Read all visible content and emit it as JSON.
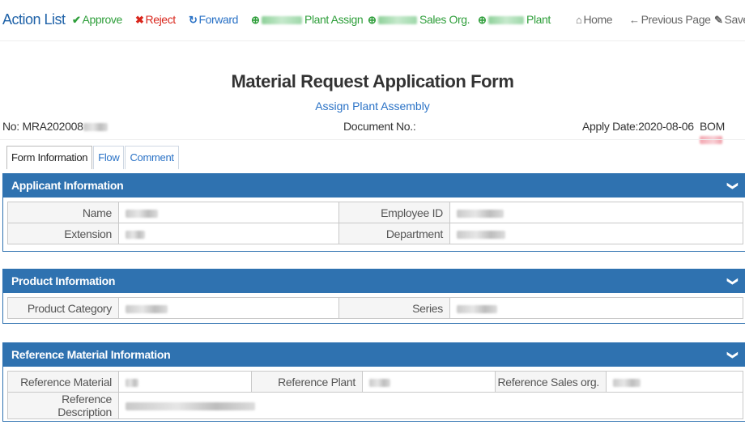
{
  "toolbar": {
    "title": "Action List",
    "approve": "Approve",
    "reject": "Reject",
    "forward": "Forward",
    "plant_assign": "Plant Assign",
    "sales_org": "Sales Org.",
    "plant": "Plant",
    "home": "Home",
    "previous_page": "Previous Page",
    "save": "Save"
  },
  "form": {
    "title": "Material Request Application Form",
    "subtitle": "Assign Plant Assembly",
    "no_label": "No: MRA202008",
    "document_no_label": "Document No.:",
    "apply_date": "Apply Date:2020-08-06",
    "bom_label": "BOM"
  },
  "tabs": [
    "Form Information",
    "Flow",
    "Comment"
  ],
  "applicant": {
    "title": "Applicant Information",
    "name_label": "Name",
    "employee_id_label": "Employee ID",
    "extension_label": "Extension",
    "department_label": "Department"
  },
  "product": {
    "title": "Product Information",
    "category_label": "Product Category",
    "series_label": "Series"
  },
  "reference": {
    "title": "Reference Material Information",
    "material_label": "Reference Material",
    "plant_label": "Reference Plant",
    "sales_org_label": "Reference Sales org.",
    "description_label": "Reference Description"
  },
  "icons": {
    "approve": "check-icon",
    "reject": "x-icon",
    "forward": "forward-icon",
    "home": "home-icon",
    "previous": "arrow-left-icon",
    "save": "save-icon",
    "collapse": "chevron-down-icon"
  },
  "colors": {
    "primary": "#2f72b0",
    "approve": "#2e9e3a",
    "reject": "#d9261c",
    "link": "#2a72c6"
  }
}
